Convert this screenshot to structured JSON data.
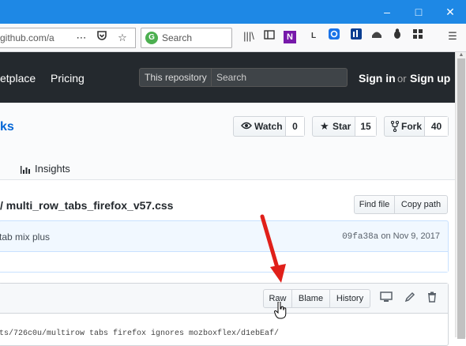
{
  "window": {
    "minimize": "–",
    "maximize": "□",
    "close": "✕"
  },
  "browser": {
    "url": "github.com/a",
    "url_prefix_fragment": "g",
    "search_placeholder": "Search",
    "toolbar_glyphs": {
      "library": "|||\\",
      "sidebar": "▭",
      "onenote": "N",
      "lastpass": "L"
    }
  },
  "github_header": {
    "nav": [
      "etplace",
      "Pricing"
    ],
    "scope_label": "This repository",
    "search_placeholder": "Search",
    "sign_in": "Sign in",
    "or": "or",
    "sign_up": "Sign up"
  },
  "repo": {
    "name_fragment": "ks",
    "watch": {
      "label": "Watch",
      "count": "0"
    },
    "star": {
      "label": "Star",
      "count": "15"
    },
    "fork": {
      "label": "Fork",
      "count": "40"
    },
    "insights_tab": "Insights"
  },
  "file": {
    "path": "/ multi_row_tabs_firefox_v57.css",
    "find_file": "Find file",
    "copy_path": "Copy path"
  },
  "commit": {
    "message": "tab mix plus",
    "sha": "09fa38a",
    "on": "on",
    "date": "Nov 9, 2017"
  },
  "file_actions": {
    "raw": "Raw",
    "blame": "Blame",
    "history": "History"
  },
  "code": {
    "first_line": "ts/726c0u/multirow tabs firefox ignores mozboxflex/d1ebEaf/"
  },
  "colors": {
    "titlebar": "#1e88e5",
    "github_header": "#24292e",
    "link": "#0366d6",
    "annotation_arrow": "#e0201a"
  }
}
